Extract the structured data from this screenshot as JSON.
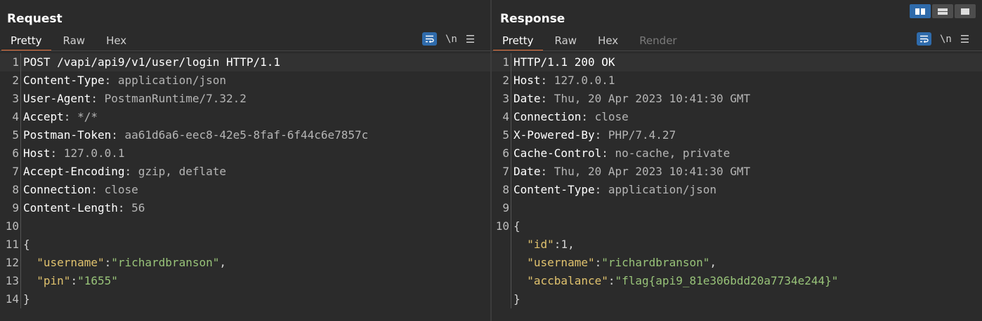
{
  "request": {
    "title": "Request",
    "tabs": [
      "Pretty",
      "Raw",
      "Hex"
    ],
    "active_tab": "Pretty",
    "newline_toggle": "\\n",
    "lines": [
      {
        "n": "1",
        "first": "POST /vapi/api9/v1/user/login HTTP/1.1"
      },
      {
        "n": "2",
        "key": "Content-Type",
        "value": " application/json"
      },
      {
        "n": "3",
        "key": "User-Agent",
        "value": " PostmanRuntime/7.32.2"
      },
      {
        "n": "4",
        "key": "Accept",
        "value": " */*"
      },
      {
        "n": "5",
        "key": "Postman-Token",
        "value": " aa61d6a6-eec8-42e5-8faf-6f44c6e7857c"
      },
      {
        "n": "6",
        "key": "Host",
        "value": " 127.0.0.1"
      },
      {
        "n": "7",
        "key": "Accept-Encoding",
        "value": " gzip, deflate"
      },
      {
        "n": "8",
        "key": "Connection",
        "value": " close"
      },
      {
        "n": "9",
        "key": "Content-Length",
        "value": " 56"
      },
      {
        "n": "10"
      },
      {
        "n": "11",
        "punct": "{"
      },
      {
        "n": "12",
        "indent": "  ",
        "jkey": "\"username\"",
        "sep": ":",
        "jval": "\"richardbranson\"",
        "end": ","
      },
      {
        "n": "13",
        "indent": "  ",
        "jkey": "\"pin\"",
        "sep": ":",
        "jval": "\"1655\"",
        "end": ""
      },
      {
        "n": "14",
        "punct": "}"
      }
    ]
  },
  "response": {
    "title": "Response",
    "tabs": [
      "Pretty",
      "Raw",
      "Hex",
      "Render"
    ],
    "active_tab": "Pretty",
    "disabled_tab": "Render",
    "newline_toggle": "\\n",
    "lines": [
      {
        "n": "1",
        "first": "HTTP/1.1 200 OK"
      },
      {
        "n": "2",
        "key": "Host",
        "value": " 127.0.0.1"
      },
      {
        "n": "3",
        "key": "Date",
        "value": " Thu, 20 Apr 2023 10:41:30 GMT"
      },
      {
        "n": "4",
        "key": "Connection",
        "value": " close"
      },
      {
        "n": "5",
        "key": "X-Powered-By",
        "value": " PHP/7.4.27"
      },
      {
        "n": "6",
        "key": "Cache-Control",
        "value": " no-cache, private"
      },
      {
        "n": "7",
        "key": "Date",
        "value": " Thu, 20 Apr 2023 10:41:30 GMT"
      },
      {
        "n": "8",
        "key": "Content-Type",
        "value": " application/json"
      },
      {
        "n": "9"
      },
      {
        "n": "10",
        "punct": "{"
      },
      {
        "n": "",
        "indent": "  ",
        "jkey": "\"id\"",
        "sep": ":",
        "jnum": "1",
        "end": ","
      },
      {
        "n": "",
        "indent": "  ",
        "jkey": "\"username\"",
        "sep": ":",
        "jval": "\"richardbranson\"",
        "end": ","
      },
      {
        "n": "",
        "indent": "  ",
        "jkey": "\"accbalance\"",
        "sep": ":",
        "jval": "\"flag{api9_81e306bdd20a7734e244}\"",
        "end": ""
      },
      {
        "n": "",
        "punct": "}"
      }
    ]
  },
  "layout_buttons": [
    "split-horizontal-icon",
    "split-vertical-icon",
    "single-pane-icon"
  ],
  "colors": {
    "background": "#2b2b2b",
    "accent_tab": "#e8703a",
    "button_blue": "#2f6bab",
    "json_key": "#e0c26e",
    "json_string": "#98c379"
  }
}
